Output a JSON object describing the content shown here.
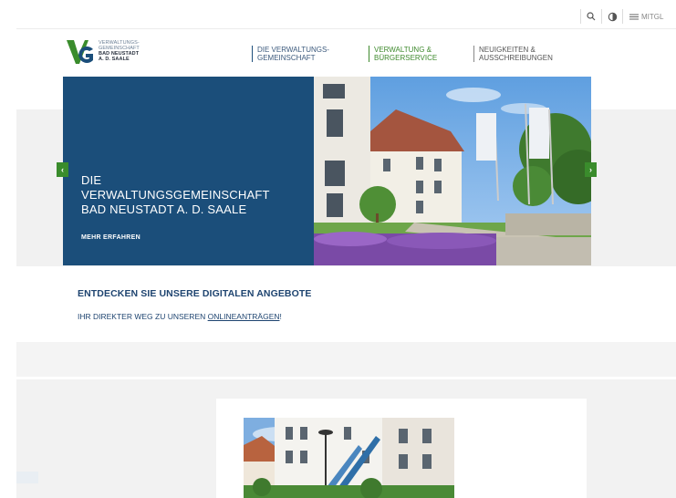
{
  "utility": {
    "search_icon": "search-icon",
    "contrast_icon": "contrast-icon",
    "menu_label": "MITGL"
  },
  "logo": {
    "line1": "VERWALTUNGS-",
    "line2": "GEMEINSCHAFT",
    "line3": "BAD NEUSTADT",
    "line4": "A. D. SAALE"
  },
  "nav": [
    {
      "line1": "DIE VERWALTUNGS-",
      "line2": "GEMEINSCHAFT"
    },
    {
      "line1": "VERWALTUNG &",
      "line2": "BÜRGERSERVICE"
    },
    {
      "line1": "NEUIGKEITEN &",
      "line2": "AUSSCHREIBUNGEN"
    }
  ],
  "hero": {
    "title1": "DIE",
    "title2": "VERWALTUNGSGEMEINSCHAFT",
    "title3": "BAD NEUSTADT A. D. SAALE",
    "link": "MEHR ERFAHREN",
    "prev": "‹",
    "next": "›"
  },
  "digital": {
    "title": "ENTDECKEN SIE UNSERE DIGITALEN ANGEBOTE",
    "sub_prefix": "IHR DIREKTER WEG ZU UNSEREN ",
    "sub_link": "ONLINEANTRÄGEN",
    "sub_suffix": "!"
  },
  "colors": {
    "brand_blue": "#1b4e7a",
    "brand_green": "#3a8c2c"
  }
}
